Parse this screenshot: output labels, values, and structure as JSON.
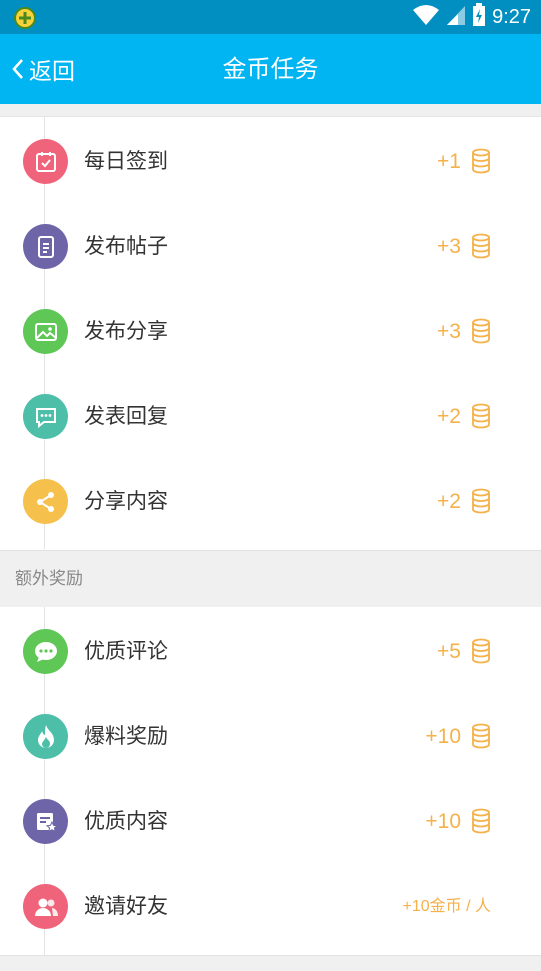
{
  "status_bar": {
    "time": "9:27"
  },
  "header": {
    "back_label": "返回",
    "title": "金币任务"
  },
  "daily_tasks": [
    {
      "label": "每日签到",
      "reward": "+1",
      "icon": "calendar-check-icon",
      "color": "#f0647b"
    },
    {
      "label": "发布帖子",
      "reward": "+3",
      "icon": "document-icon",
      "color": "#6d65a8"
    },
    {
      "label": "发布分享",
      "reward": "+3",
      "icon": "image-icon",
      "color": "#5ec756"
    },
    {
      "label": "发表回复",
      "reward": "+2",
      "icon": "chat-bubble-icon",
      "color": "#4dbfa8"
    },
    {
      "label": "分享内容",
      "reward": "+2",
      "icon": "share-icon",
      "color": "#f6c04d"
    }
  ],
  "extra_section_title": "额外奖励",
  "extra_tasks": [
    {
      "label": "优质评论",
      "reward": "+5",
      "icon": "comment-icon",
      "color": "#5ec756"
    },
    {
      "label": "爆料奖励",
      "reward": "+10",
      "icon": "flame-icon",
      "color": "#4dbfa8"
    },
    {
      "label": "优质内容",
      "reward": "+10",
      "icon": "starred-document-icon",
      "color": "#6d65a8"
    },
    {
      "label": "邀请好友",
      "reward": "+10金币 / 人",
      "icon": "users-icon",
      "color": "#f0647b"
    }
  ],
  "reward_color": "#f5b14a"
}
